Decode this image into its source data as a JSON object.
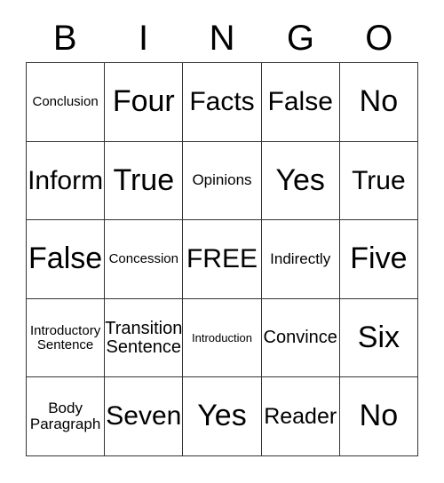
{
  "card": {
    "title": "BINGO",
    "header_letters": [
      "B",
      "I",
      "N",
      "G",
      "O"
    ],
    "free_space_label": "FREE",
    "colors": {
      "background": "#ffffff",
      "text": "#000000",
      "grid_line": "#333333"
    },
    "rows": [
      [
        {
          "text": "Conclusion",
          "size": "fs-s"
        },
        {
          "text": "Four",
          "size": "fs-huge"
        },
        {
          "text": "Facts",
          "size": "fs-xxl"
        },
        {
          "text": "False",
          "size": "fs-xxl"
        },
        {
          "text": "No",
          "size": "fs-huge"
        }
      ],
      [
        {
          "text": "Inform",
          "size": "fs-xxl"
        },
        {
          "text": "True",
          "size": "fs-huge"
        },
        {
          "text": "Opinions",
          "size": "fs-m"
        },
        {
          "text": "Yes",
          "size": "fs-huge"
        },
        {
          "text": "True",
          "size": "fs-xxl"
        }
      ],
      [
        {
          "text": "False",
          "size": "fs-huge"
        },
        {
          "text": "Concession",
          "size": "fs-s"
        },
        {
          "text": "FREE",
          "size": "fs-xxl"
        },
        {
          "text": "Indirectly",
          "size": "fs-m"
        },
        {
          "text": "Five",
          "size": "fs-huge"
        }
      ],
      [
        {
          "text": "Introductory\nSentence",
          "size": "fs-s"
        },
        {
          "text": "Transition\nSentence",
          "size": "fs-l"
        },
        {
          "text": "Introduction",
          "size": "fs-xs"
        },
        {
          "text": "Convince",
          "size": "fs-l"
        },
        {
          "text": "Six",
          "size": "fs-huge"
        }
      ],
      [
        {
          "text": "Body\nParagraph",
          "size": "fs-m"
        },
        {
          "text": "Seven",
          "size": "fs-xxl"
        },
        {
          "text": "Yes",
          "size": "fs-huge"
        },
        {
          "text": "Reader",
          "size": "fs-xl"
        },
        {
          "text": "No",
          "size": "fs-huge"
        }
      ]
    ]
  }
}
